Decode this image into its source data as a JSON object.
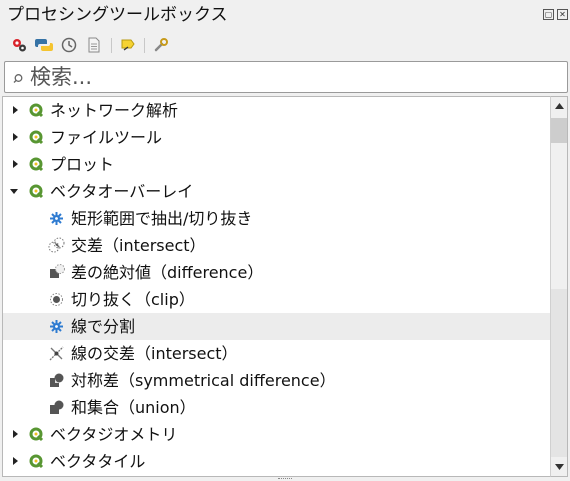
{
  "panel": {
    "title": "プロセシングツールボックス"
  },
  "toolbar": {
    "buttons": [
      {
        "icon": "models-icon"
      },
      {
        "icon": "python-scripts-icon"
      },
      {
        "icon": "history-icon"
      },
      {
        "icon": "results-viewer-icon"
      },
      {
        "icon": "edit-features-in-place-icon"
      },
      {
        "icon": "options-wrench-icon"
      }
    ]
  },
  "search": {
    "placeholder": "検索..."
  },
  "tree": {
    "groups": [
      {
        "label": "ネットワーク解析"
      },
      {
        "label": "ファイルツール"
      },
      {
        "label": "プロット"
      },
      {
        "label": "ベクタオーバーレイ"
      }
    ],
    "overlay_items": [
      {
        "label": "矩形範囲で抽出/切り抜き",
        "icon": "gear-icon"
      },
      {
        "label": "交差（intersect）",
        "icon": "intersect-icon"
      },
      {
        "label": "差の絶対値（difference）",
        "icon": "difference-icon"
      },
      {
        "label": "切り抜く（clip）",
        "icon": "clip-icon"
      },
      {
        "label": "線で分割",
        "icon": "gear-icon"
      },
      {
        "label": "線の交差（intersect）",
        "icon": "line-intersections-icon"
      },
      {
        "label": "対称差（symmetrical difference）",
        "icon": "symmetrical-difference-icon"
      },
      {
        "label": "和集合（union）",
        "icon": "union-icon"
      }
    ],
    "groups_after": [
      {
        "label": "ベクタジオメトリ"
      },
      {
        "label": "ベクタタイル"
      }
    ]
  },
  "colors": {
    "qgis_green": "#589632",
    "gear_blue": "#2e7bd1",
    "selection": "#ececec"
  }
}
